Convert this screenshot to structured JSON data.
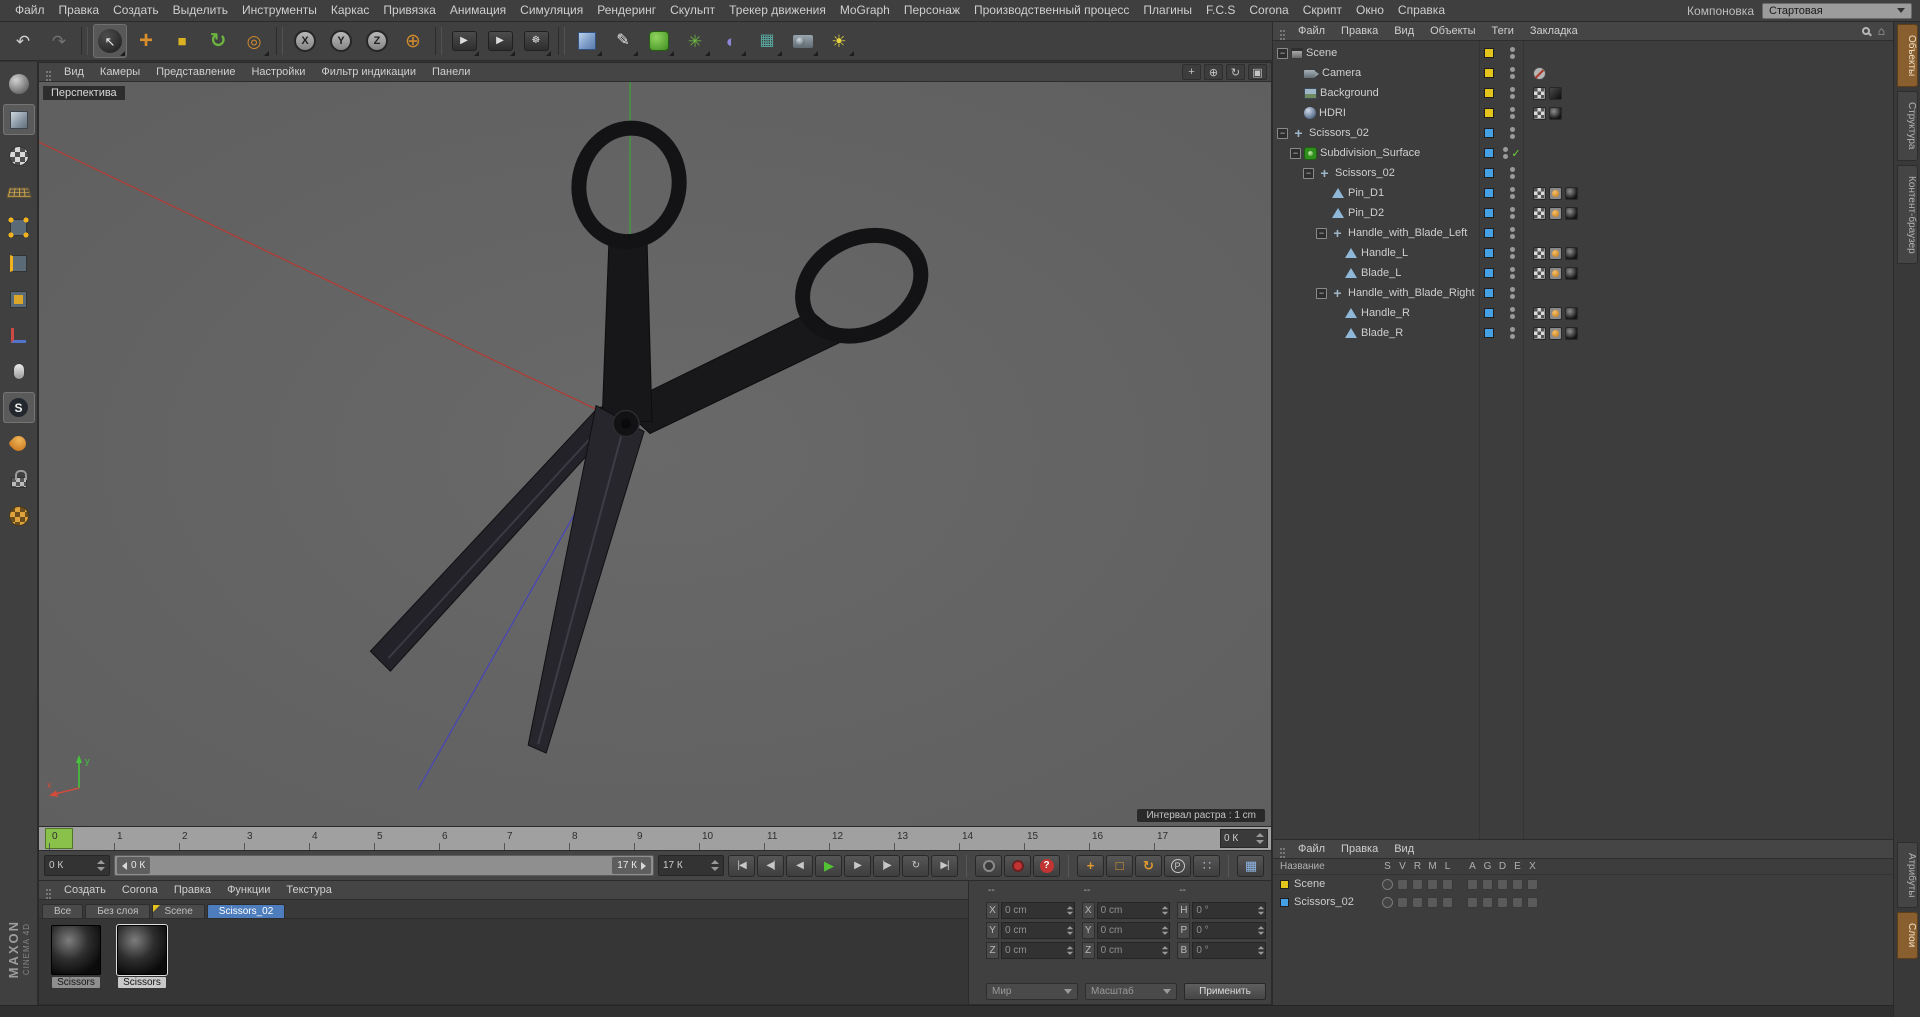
{
  "colors": {
    "accent_orange": "#d98f2b",
    "selection_blue": "#4d7dbd",
    "layer_yellow": "#e3c51c",
    "layer_blue": "#45a0e6",
    "axis_x_red": "#b23b35",
    "axis_y_green": "#3f9e3a",
    "axis_z_blue": "#4946b5",
    "play_green": "#52c433",
    "record_red": "#c23333",
    "subdiv_green": "#3fae29",
    "viewport_gray": "#656565",
    "playhead_green": "#86c440"
  },
  "menubar": {
    "items": [
      "Файл",
      "Правка",
      "Создать",
      "Выделить",
      "Инструменты",
      "Каркас",
      "Привязка",
      "Анимация",
      "Симуляция",
      "Рендеринг",
      "Скульпт",
      "Трекер движения",
      "MoGraph",
      "Персонаж",
      "Производственный процесс",
      "Плагины",
      "F.C.S",
      "Corona",
      "Скрипт",
      "Окно",
      "Справка"
    ],
    "layout_label": "Компоновка",
    "layout_value": "Стартовая"
  },
  "toolbar": {
    "items": [
      {
        "name": "undo-button",
        "kind": "plain",
        "glyph": "↶"
      },
      {
        "name": "redo-button",
        "kind": "plain",
        "glyph": "↷",
        "disabled": true
      },
      {
        "name": "toolbar-separator",
        "kind": "sep"
      },
      {
        "name": "live-selection-tool",
        "kind": "circle-dark",
        "glyph": "↖",
        "active": true,
        "flyout": true
      },
      {
        "name": "move-tool",
        "kind": "move",
        "glyph": "+"
      },
      {
        "name": "scale-tool",
        "kind": "scale",
        "glyph": "■"
      },
      {
        "name": "rotate-tool",
        "kind": "rotate",
        "glyph": "↻"
      },
      {
        "name": "last-used-tool",
        "kind": "last",
        "glyph": "◎",
        "flyout": true
      },
      {
        "name": "toolbar-separator",
        "kind": "sep"
      },
      {
        "name": "lock-x-axis-button",
        "kind": "ring",
        "glyph": "X"
      },
      {
        "name": "lock-y-axis-button",
        "kind": "ring",
        "glyph": "Y"
      },
      {
        "name": "lock-z-axis-button",
        "kind": "ring",
        "glyph": "Z"
      },
      {
        "name": "coordinate-system-button",
        "kind": "coord",
        "glyph": "⊕"
      },
      {
        "name": "toolbar-separator",
        "kind": "sep"
      },
      {
        "name": "render-view-button",
        "kind": "render",
        "glyph": "▶",
        "flyout": true
      },
      {
        "name": "render-picture-viewer-button",
        "kind": "render",
        "glyph": "▶",
        "flyout": true
      },
      {
        "name": "render-settings-button",
        "kind": "render",
        "glyph": "☸",
        "flyout": true
      },
      {
        "name": "toolbar-separator",
        "kind": "sep"
      },
      {
        "name": "primitive-cube-button",
        "kind": "cube3d",
        "flyout": true
      },
      {
        "name": "spline-pen-button",
        "kind": "pen",
        "glyph": "✎",
        "flyout": true
      },
      {
        "name": "generators-button",
        "kind": "gen",
        "flyout": true
      },
      {
        "name": "modeling-objects-button",
        "kind": "mod",
        "glyph": "✳",
        "flyout": true
      },
      {
        "name": "deformers-button",
        "kind": "def",
        "glyph": "◐",
        "flyout": true
      },
      {
        "name": "environment-objects-button",
        "kind": "env",
        "glyph": "▦",
        "flyout": true
      },
      {
        "name": "camera-button",
        "kind": "camera-css",
        "flyout": true
      },
      {
        "name": "lights-button",
        "kind": "light",
        "glyph": "☀",
        "flyout": true
      }
    ]
  },
  "left_toolbar": {
    "items": [
      {
        "name": "make-editable-button",
        "kind": "sphere"
      },
      {
        "name": "model-mode-button",
        "kind": "cube",
        "active": true
      },
      {
        "name": "texture-mode-button",
        "kind": "checker-sphere"
      },
      {
        "name": "workplane-mode-button",
        "kind": "workplane"
      },
      {
        "name": "points-mode-button",
        "kind": "points"
      },
      {
        "name": "edges-mode-button",
        "kind": "edges"
      },
      {
        "name": "polygons-mode-button",
        "kind": "polys"
      },
      {
        "name": "axis-mode-button",
        "kind": "axis"
      },
      {
        "name": "mouse-interaction-button",
        "kind": "mouse"
      },
      {
        "name": "snap-button",
        "kind": "snap",
        "glyph": "S",
        "active": true
      },
      {
        "name": "paint-button",
        "kind": "paint"
      },
      {
        "name": "lock-workplane-button",
        "kind": "lockplane"
      },
      {
        "name": "uv-mode-button",
        "kind": "uvsphere"
      }
    ]
  },
  "viewport": {
    "menu": [
      "Вид",
      "Камеры",
      "Представление",
      "Настройки",
      "Фильтр индикации",
      "Панели"
    ],
    "label": "Перспектива",
    "raster_text": "Интервал растра : 1 cm",
    "nav_icons": [
      {
        "name": "pan-view-icon",
        "glyph": "+"
      },
      {
        "name": "zoom-view-icon",
        "glyph": "⊕"
      },
      {
        "name": "rotate-view-icon",
        "glyph": "↻"
      },
      {
        "name": "maximize-view-icon",
        "glyph": "▣"
      }
    ],
    "axis_labels": {
      "x": "x",
      "y": "y"
    }
  },
  "timeline": {
    "ticks": [
      "0",
      "1",
      "2",
      "3",
      "4",
      "5",
      "6",
      "7",
      "8",
      "9",
      "10",
      "11",
      "12",
      "13",
      "14",
      "15",
      "16",
      "17"
    ],
    "end_spin": "0 К"
  },
  "transport": {
    "current_frame": "0 К",
    "range_start": "0 К",
    "range_end": "17 К",
    "end_frame": "17 К",
    "timeline_glyph": "▦",
    "buttons": [
      {
        "name": "goto-start-button",
        "glyph": "|◀"
      },
      {
        "name": "prev-key-button",
        "glyph": "◀|"
      },
      {
        "name": "prev-frame-button",
        "glyph": "◀"
      },
      {
        "name": "play-button",
        "glyph": "▶",
        "kind": "play"
      },
      {
        "name": "next-frame-button",
        "glyph": "▶"
      },
      {
        "name": "next-key-button",
        "glyph": "|▶"
      },
      {
        "name": "loop-button",
        "glyph": "↻"
      },
      {
        "name": "goto-end-button",
        "glyph": "▶|"
      }
    ],
    "record_buttons": [
      {
        "name": "record-keyframe-button",
        "kind": "dim",
        "glyph": ""
      },
      {
        "name": "record-autokey-button",
        "kind": "red-ring",
        "glyph": ""
      },
      {
        "name": "keyframe-mode-button",
        "kind": "red",
        "glyph": "?"
      }
    ],
    "key_buttons": [
      {
        "name": "key-position-button",
        "kind": "orange",
        "glyph": "+"
      },
      {
        "name": "key-scale-button",
        "kind": "orange",
        "glyph": "□"
      },
      {
        "name": "key-rotation-button",
        "kind": "orange",
        "glyph": "↻"
      },
      {
        "name": "key-parameter-button",
        "kind": "ring",
        "glyph": "P"
      },
      {
        "name": "key-pla-button",
        "kind": "plain",
        "glyph": "∷"
      }
    ]
  },
  "materials": {
    "menu": [
      "Создать",
      "Corona",
      "Правка",
      "Функции",
      "Текстура"
    ],
    "tabs": [
      {
        "label": "Все"
      },
      {
        "label": "Без слоя"
      },
      {
        "label": "Scene",
        "flag": "yellow"
      },
      {
        "label": "Scissors_02",
        "active": true
      }
    ],
    "items": [
      {
        "label": "Scissors"
      },
      {
        "label": "Scissors",
        "active": true
      }
    ]
  },
  "coordinates": {
    "headers": {
      "pos": "--",
      "size": "--",
      "rot": "--"
    },
    "pos_rows": [
      {
        "label": "X",
        "value": "0 cm"
      },
      {
        "label": "Y",
        "value": "0 cm"
      },
      {
        "label": "Z",
        "value": "0 cm"
      }
    ],
    "size_rows": [
      {
        "label": "X",
        "value": "0 cm"
      },
      {
        "label": "Y",
        "value": "0 cm"
      },
      {
        "label": "Z",
        "value": "0 cm"
      }
    ],
    "rot_rows": [
      {
        "label": "H",
        "value": "0 °"
      },
      {
        "label": "P",
        "value": "0 °"
      },
      {
        "label": "B",
        "value": "0 °"
      }
    ],
    "space_dropdown": "Мир",
    "mode_dropdown": "Масштаб",
    "apply_button": "Применить"
  },
  "object_manager": {
    "menu": [
      "Файл",
      "Правка",
      "Вид",
      "Объекты",
      "Теги",
      "Закладка"
    ],
    "home_glyph": "⌂",
    "collapse_glyph": "−",
    "check_glyph": "✓",
    "rows": [
      {
        "label": "Scene",
        "depth": 0,
        "expander": true,
        "icon": "scene",
        "chip": "#e3c51c",
        "tags": []
      },
      {
        "label": "Camera",
        "depth": 1,
        "expander": false,
        "icon": "camera",
        "chip": "#e3c51c",
        "tags": [
          "prohibition"
        ]
      },
      {
        "label": "Background",
        "depth": 1,
        "expander": false,
        "icon": "background",
        "chip": "#e3c51c",
        "tags": [
          "uvw",
          "compositing"
        ]
      },
      {
        "label": "HDRI",
        "depth": 1,
        "expander": false,
        "icon": "hdri",
        "chip": "#e3c51c",
        "tags": [
          "uvw",
          "material"
        ]
      },
      {
        "label": "Scissors_02",
        "depth": 0,
        "expander": true,
        "icon": "null",
        "chip": "#45a0e6",
        "tags": []
      },
      {
        "label": "Subdivision_Surface",
        "depth": 1,
        "expander": true,
        "icon": "subdiv",
        "chip": "#45a0e6",
        "check": true,
        "tags": []
      },
      {
        "label": "Scissors_02",
        "depth": 2,
        "expander": true,
        "icon": "null",
        "chip": "#45a0e6",
        "tags": []
      },
      {
        "label": "Pin_D1",
        "depth": 3,
        "expander": false,
        "icon": "mesh",
        "chip": "#45a0e6",
        "tags": [
          "uvw",
          "phong",
          "material"
        ]
      },
      {
        "label": "Pin_D2",
        "depth": 3,
        "expander": false,
        "icon": "mesh",
        "chip": "#45a0e6",
        "tags": [
          "uvw",
          "phong",
          "material"
        ]
      },
      {
        "label": "Handle_with_Blade_Left",
        "depth": 3,
        "expander": true,
        "icon": "null",
        "chip": "#45a0e6",
        "tags": []
      },
      {
        "label": "Handle_L",
        "depth": 4,
        "expander": false,
        "icon": "mesh",
        "chip": "#45a0e6",
        "tags": [
          "uvw",
          "phong",
          "material"
        ]
      },
      {
        "label": "Blade_L",
        "depth": 4,
        "expander": false,
        "icon": "mesh",
        "chip": "#45a0e6",
        "tags": [
          "uvw",
          "phong",
          "material"
        ]
      },
      {
        "label": "Handle_with_Blade_Right",
        "depth": 3,
        "expander": true,
        "icon": "null",
        "chip": "#45a0e6",
        "tags": []
      },
      {
        "label": "Handle_R",
        "depth": 4,
        "expander": false,
        "icon": "mesh",
        "chip": "#45a0e6",
        "tags": [
          "uvw",
          "phong",
          "material"
        ]
      },
      {
        "label": "Blade_R",
        "depth": 4,
        "expander": false,
        "icon": "mesh",
        "chip": "#45a0e6",
        "tags": [
          "uvw",
          "phong",
          "material"
        ]
      }
    ]
  },
  "layer_manager": {
    "menu": [
      "Файл",
      "Правка",
      "Вид"
    ],
    "name_header": "Название",
    "columns": [
      "S",
      "V",
      "R",
      "M",
      "L",
      "A",
      "G",
      "D",
      "E",
      "X"
    ],
    "rows": [
      {
        "label": "Scene",
        "chip": "#e3c51c"
      },
      {
        "label": "Scissors_02",
        "chip": "#45a0e6"
      }
    ]
  },
  "side_tabs": {
    "top": [
      {
        "label": "Объекты",
        "active": true
      },
      {
        "label": "Структура"
      },
      {
        "label": "Контент-браузер"
      }
    ],
    "bottom": [
      {
        "label": "Атрибуты"
      },
      {
        "label": "Слои",
        "active": true
      }
    ]
  },
  "branding": {
    "logo_maxon": "MAXON",
    "logo_cinema": "CINEMA 4D"
  }
}
